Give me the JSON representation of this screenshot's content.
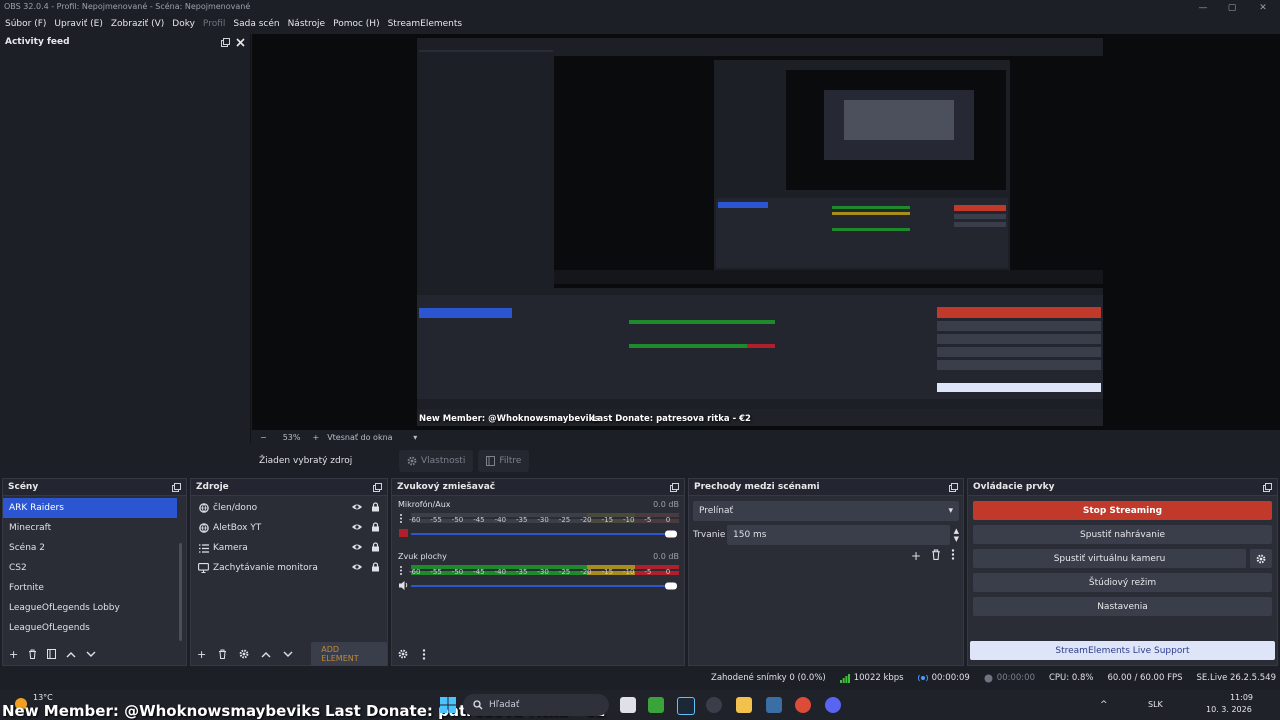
{
  "window": {
    "title": "OBS 32.0.4 - Profil: Nepojmenované - Scéna: Nepojmenované",
    "controls": [
      "—",
      "▢",
      "✕"
    ]
  },
  "menu": [
    {
      "label": "Súbor (F)"
    },
    {
      "label": "Upraviť (E)"
    },
    {
      "label": "Zobraziť (V)"
    },
    {
      "label": "Doky"
    },
    {
      "label": "Profil",
      "dim": true
    },
    {
      "label": "Sada scén"
    },
    {
      "label": "Nástroje"
    },
    {
      "label": "Pomoc (H)"
    },
    {
      "label": "StreamElements"
    }
  ],
  "activity_feed": {
    "title": "Activity feed"
  },
  "preview": {
    "zoom": "53%",
    "zoom_mode": "Vtesnať do okna",
    "overlay_member": "New Member: @Whoknowsmaybeviks",
    "overlay_donate": "Last Donate: patresova ritka - €2"
  },
  "source_toolbar": {
    "no_selection": "Žiaden vybratý zdroj",
    "properties": "Vlastnosti",
    "filters": "Filtre"
  },
  "scenes": {
    "title": "Scény",
    "items": [
      "ARK Raiders",
      "Minecraft",
      "Scéna 2",
      "CS2",
      "Fortnite",
      "LeagueOfLegends Lobby",
      "LeagueOfLegends"
    ],
    "selected": 0
  },
  "sources": {
    "title": "Zdroje",
    "items": [
      {
        "label": "člen/dono",
        "icon": "browser-icon"
      },
      {
        "label": "AletBox YT",
        "icon": "browser-icon"
      },
      {
        "label": "Kamera",
        "icon": "list-icon"
      },
      {
        "label": "Zachytávanie monitora",
        "icon": "monitor-icon"
      }
    ],
    "add_element": "ADD ELEMENT"
  },
  "mixer": {
    "title": "Zvukový zmiešavač",
    "channels": [
      {
        "name": "Mikrofón/Aux",
        "db": "0.0 dB",
        "muted": true,
        "level": 0.0
      },
      {
        "name": "Zvuk plochy",
        "db": "0.0 dB",
        "muted": false,
        "level": 1.0
      }
    ],
    "ticks": [
      "-60",
      "-55",
      "-50",
      "-45",
      "-40",
      "-35",
      "-30",
      "-25",
      "-20",
      "-15",
      "-10",
      "-5",
      "0"
    ]
  },
  "transitions": {
    "title": "Prechody medzi scénami",
    "selected": "Prelínať",
    "duration_label": "Trvanie",
    "duration_value": "150 ms"
  },
  "controls": {
    "title": "Ovládacie prvky",
    "stop_streaming": "Stop Streaming",
    "start_recording": "Spustiť nahrávanie",
    "start_virtualcam": "Spustiť virtuálnu kameru",
    "studio_mode": "Štúdiový režim",
    "settings": "Nastavenia",
    "support": "StreamElements Live Support"
  },
  "status": {
    "dropped": "Zahodené snímky 0 (0.0%)",
    "bitrate": "10022 kbps",
    "stream_time": "00:00:09",
    "rec_time": "00:00:00",
    "cpu": "CPU: 0.8%",
    "fps": "60.00 / 60.00 FPS",
    "se_version": "SE.Live 26.2.5.549"
  },
  "taskbar": {
    "weather_temp": "13°C",
    "search": "Hľadať",
    "lang": "SLK",
    "time": "11:09",
    "date": "10. 3. 2026"
  },
  "colors": {
    "accent_selected": "#2b55d1",
    "stop_streaming": "#c0392b",
    "support_bg": "#dfe5f8",
    "meter_green": "#1f8a2b",
    "meter_yellow": "#a88d1c",
    "meter_red": "#b0202a"
  }
}
